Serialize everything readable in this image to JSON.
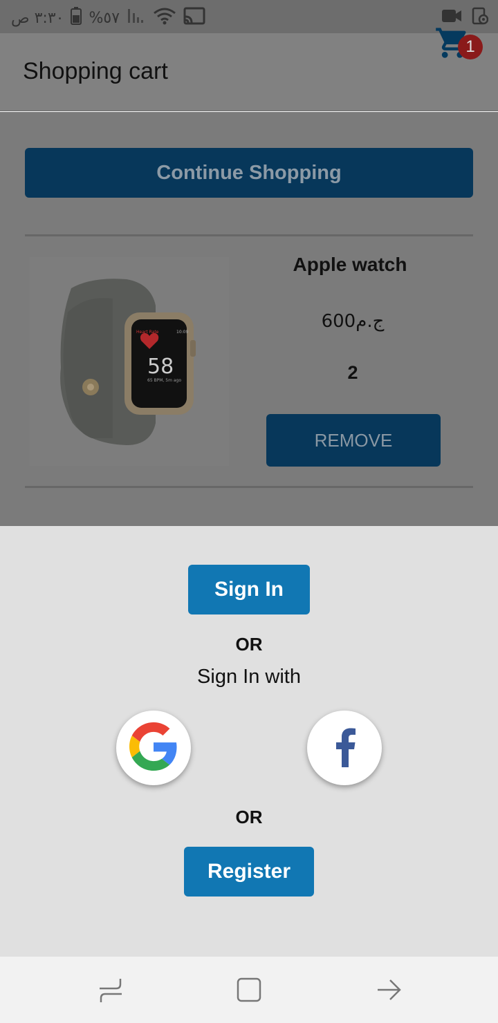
{
  "status_bar": {
    "time": "٣:٣٠ ص",
    "battery": "%٥٧",
    "icons": [
      "battery-icon",
      "signal-icon",
      "wifi-icon",
      "cast-icon",
      "video-icon",
      "screen-record-icon"
    ]
  },
  "app_bar": {
    "title": "Shopping cart",
    "cart_icon": "cart-icon",
    "cart_count": "1"
  },
  "main": {
    "continue_label": "Continue Shopping",
    "cart_items": [
      {
        "name": "Apple watch",
        "price": "600ج.م",
        "quantity": "2",
        "remove_label": "REMOVE",
        "image_icon": "apple-watch-image",
        "watch_face_time": "10:09",
        "watch_face_label": "Heart Rate",
        "watch_face_value": "58",
        "watch_face_sub": "65 BPM, 5m ago"
      }
    ]
  },
  "sheet": {
    "signin_label": "Sign In",
    "or_label_1": "OR",
    "signin_with_label": "Sign In with",
    "or_label_2": "OR",
    "register_label": "Register",
    "google_icon": "google-icon",
    "facebook_icon": "facebook-icon"
  },
  "nav_bar": {
    "icons": [
      "recents-icon",
      "home-icon",
      "back-icon"
    ]
  },
  "colors": {
    "primary": "#1177b3",
    "primary_dimmed": "#07375a",
    "badge": "#8a1a1a",
    "sheet_bg": "#e0e0e0",
    "overlay_bg": "#7b7b7b"
  }
}
